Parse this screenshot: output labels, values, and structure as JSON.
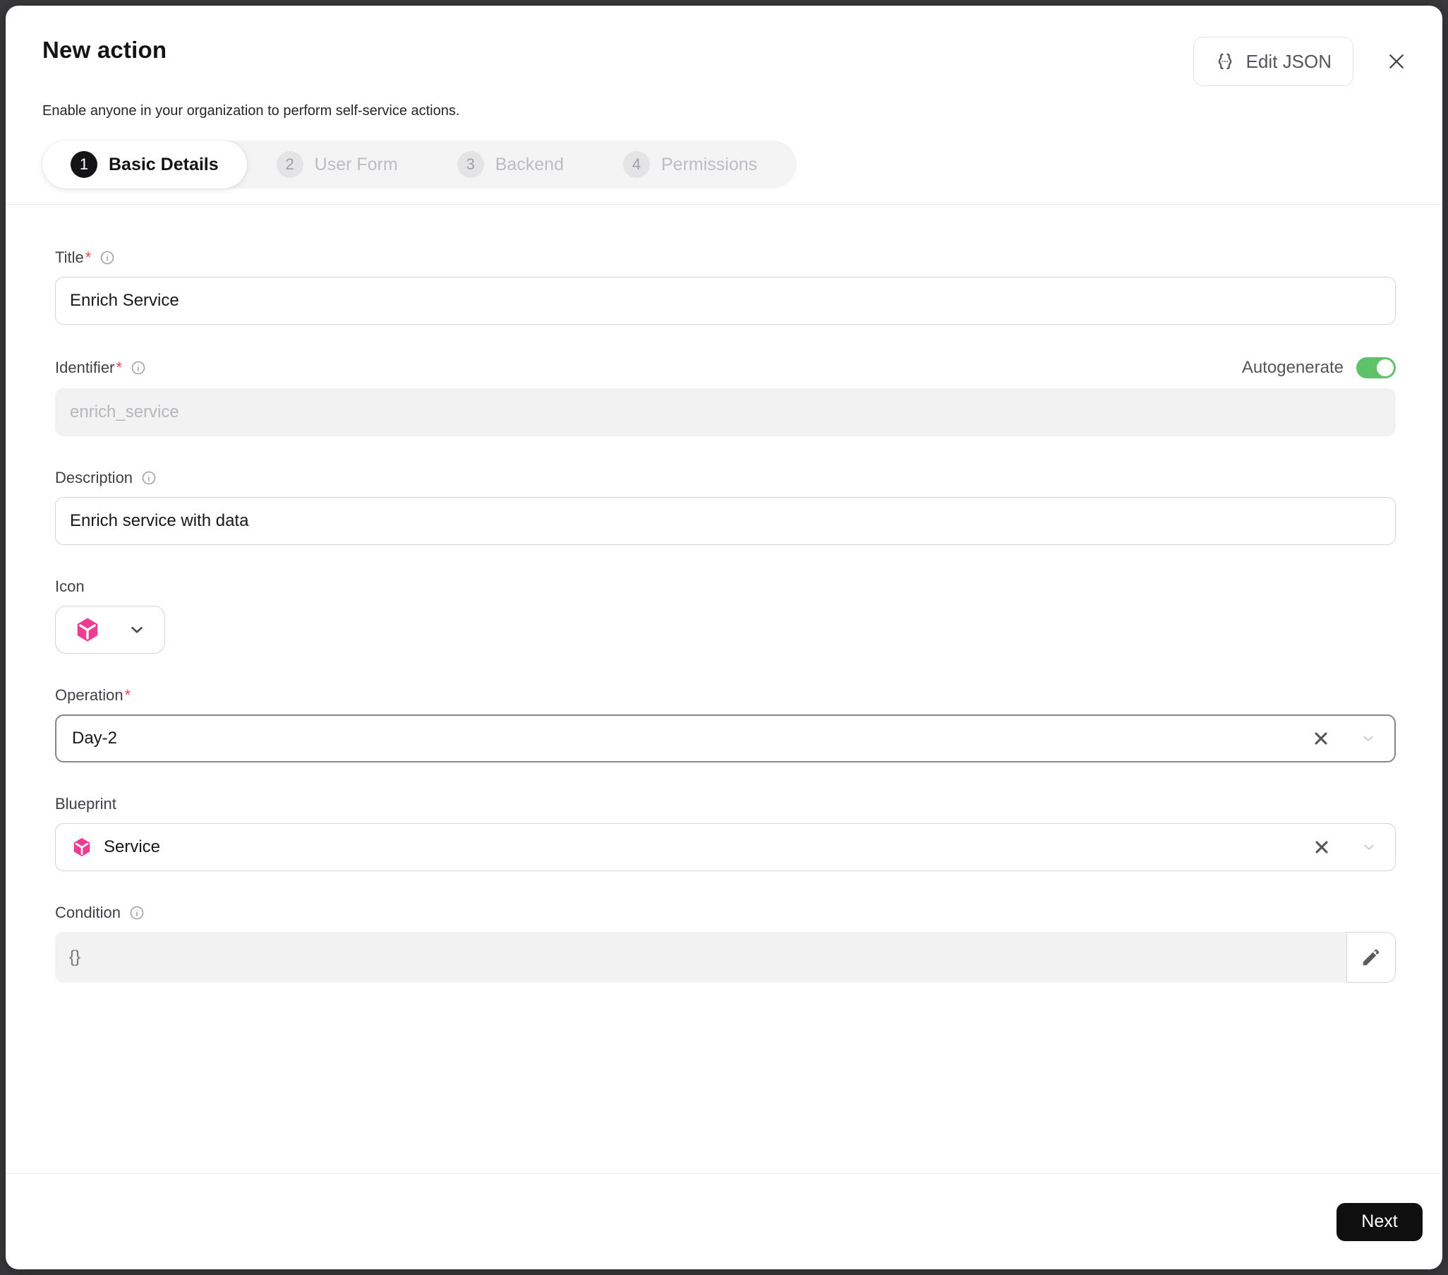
{
  "header": {
    "title": "New action",
    "subtitle": "Enable anyone in your organization to perform self-service actions.",
    "edit_json_label": "Edit JSON"
  },
  "stepper": {
    "steps": [
      {
        "number": "1",
        "label": "Basic Details",
        "active": true
      },
      {
        "number": "2",
        "label": "User Form",
        "active": false
      },
      {
        "number": "3",
        "label": "Backend",
        "active": false
      },
      {
        "number": "4",
        "label": "Permissions",
        "active": false
      }
    ]
  },
  "form": {
    "title": {
      "label": "Title",
      "required": "*",
      "value": "Enrich Service"
    },
    "identifier": {
      "label": "Identifier",
      "required": "*",
      "value": "enrich_service",
      "autogenerate_label": "Autogenerate",
      "autogenerate_on": true
    },
    "description": {
      "label": "Description",
      "value": "Enrich service with data"
    },
    "icon": {
      "label": "Icon",
      "selected_icon": "service-cube-icon"
    },
    "operation": {
      "label": "Operation",
      "required": "*",
      "value": "Day-2"
    },
    "blueprint": {
      "label": "Blueprint",
      "value": "Service",
      "value_icon": "service-cube-icon"
    },
    "condition": {
      "label": "Condition",
      "placeholder": "{}"
    }
  },
  "footer": {
    "next_label": "Next"
  },
  "colors": {
    "toggle_on_green": "#5ec269",
    "blueprint_pink": "#ec3d93",
    "primary_button_black": "#0f0f10",
    "required_red": "#e5484d"
  }
}
